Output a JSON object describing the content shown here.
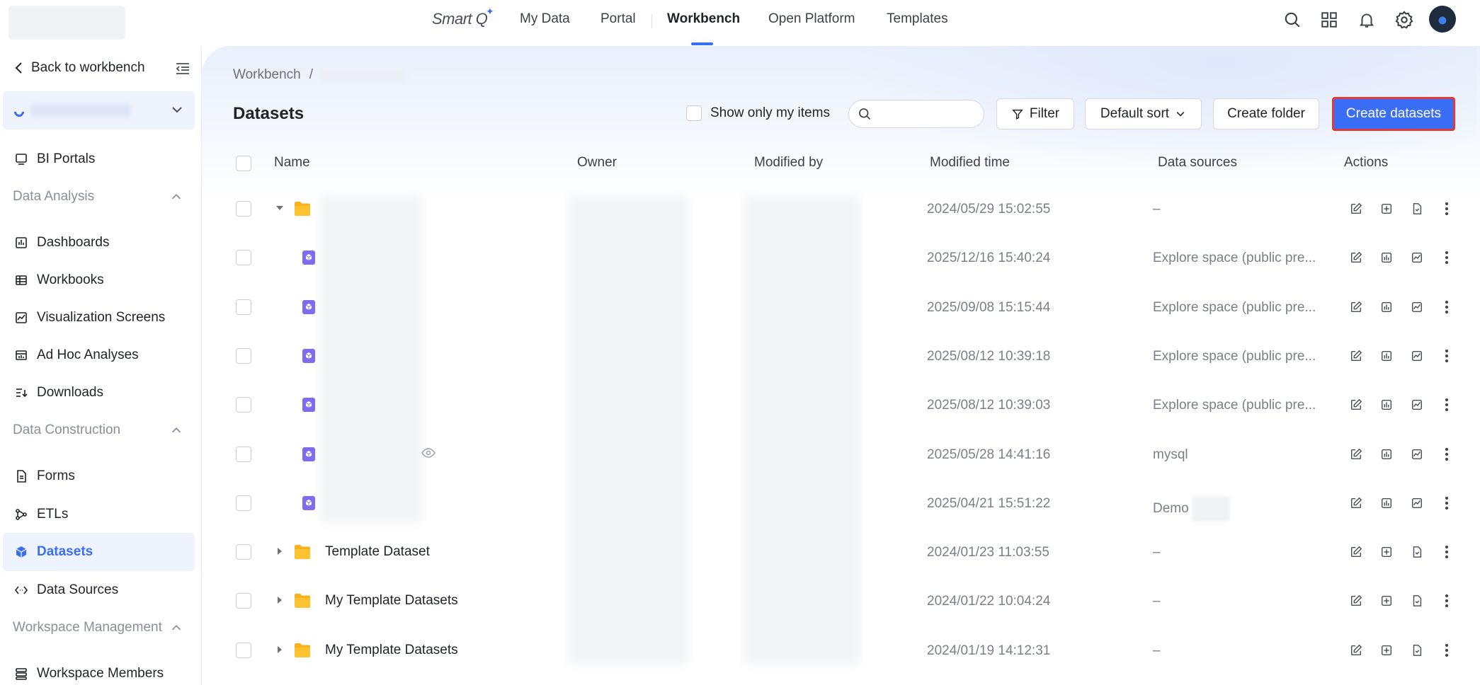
{
  "topbar": {
    "brand": "Smart Q",
    "nav": [
      "My Data",
      "Portal",
      "Workbench",
      "Open Platform",
      "Templates"
    ],
    "active_nav": "Workbench",
    "icons": [
      "search-icon",
      "apps-grid-icon",
      "bell-icon",
      "gear-icon",
      "user-avatar"
    ]
  },
  "sidebar": {
    "back_label": "Back to workbench",
    "items": {
      "bi_portals": "BI Portals",
      "group_analysis": "Data Analysis",
      "dashboards": "Dashboards",
      "workbooks": "Workbooks",
      "visualization_screens": "Visualization Screens",
      "ad_hoc": "Ad Hoc Analyses",
      "downloads": "Downloads",
      "group_construction": "Data Construction",
      "forms": "Forms",
      "etls": "ETLs",
      "datasets": "Datasets",
      "data_sources": "Data Sources",
      "group_workspace": "Workspace Management",
      "workspace_members": "Workspace Members"
    },
    "active_item": "Datasets"
  },
  "main": {
    "breadcrumb_root": "Workbench",
    "breadcrumb_sep": "/",
    "title": "Datasets",
    "show_mine_label": "Show only my items",
    "search_placeholder": "",
    "filter_label": "Filter",
    "sort_label": "Default sort",
    "create_folder_label": "Create folder",
    "create_datasets_label": "Create datasets"
  },
  "table": {
    "columns": {
      "name": "Name",
      "owner": "Owner",
      "modified_by": "Modified by",
      "modified_time": "Modified time",
      "data_sources": "Data sources",
      "actions": "Actions"
    },
    "rows": [
      {
        "kind": "folder-open",
        "name": "",
        "time": "2024/05/29 15:02:55",
        "source": "–"
      },
      {
        "kind": "dataset",
        "name": "",
        "time": "2025/12/16 15:40:24",
        "source": "Explore space (public pre..."
      },
      {
        "kind": "dataset",
        "name": "",
        "time": "2025/09/08 15:15:44",
        "source": "Explore space (public pre..."
      },
      {
        "kind": "dataset",
        "name": "",
        "time": "2025/08/12 10:39:18",
        "source": "Explore space (public pre..."
      },
      {
        "kind": "dataset",
        "name": "",
        "time": "2025/08/12 10:39:03",
        "source": "Explore space (public pre..."
      },
      {
        "kind": "dataset",
        "name": "",
        "time": "2025/05/28 14:41:16",
        "source": "mysql"
      },
      {
        "kind": "dataset",
        "name": "",
        "time": "2025/04/21 15:51:22",
        "source": "Demo"
      },
      {
        "kind": "folder",
        "name": "Template Dataset",
        "time": "2024/01/23 11:03:55",
        "source": "–"
      },
      {
        "kind": "folder",
        "name": "My Template Datasets",
        "time": "2024/01/22 10:04:24",
        "source": "–"
      },
      {
        "kind": "folder",
        "name": "My Template Datasets",
        "time": "2024/01/19 14:12:31",
        "source": "–"
      }
    ]
  },
  "colors": {
    "accent": "#3b6ef6",
    "folder": "#f7b21a",
    "dataset_icon": "#7b6cf0",
    "highlight_border": "#e03a3a"
  }
}
